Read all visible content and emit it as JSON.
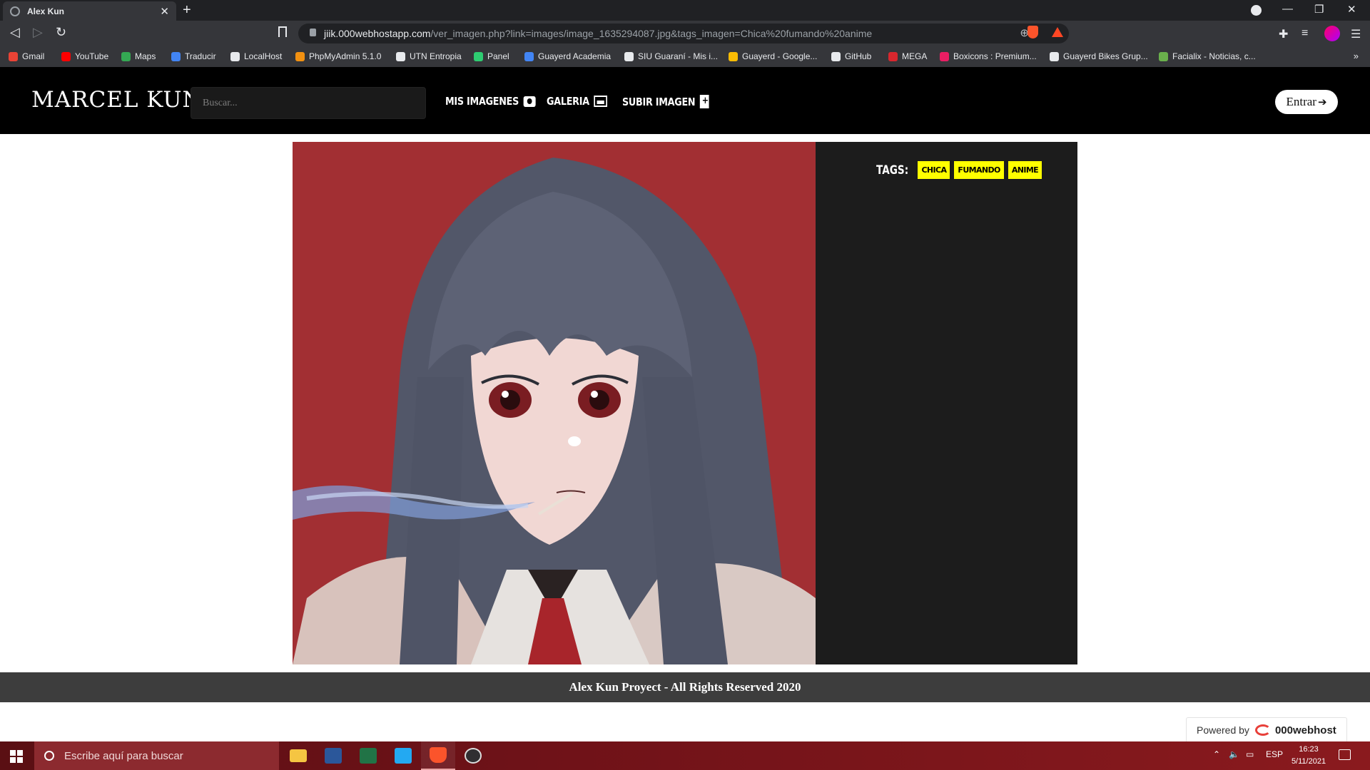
{
  "browser": {
    "tab_title": "Alex Kun",
    "url_host": "jiik.000webhostapp.com",
    "url_path": "/ver_imagen.php?link=images/image_1635294087.jpg&tags_imagen=Chica%20fumando%20anime",
    "bookmarks": [
      {
        "label": "Gmail",
        "color": "#ea4335"
      },
      {
        "label": "YouTube",
        "color": "#ff0000"
      },
      {
        "label": "Maps",
        "color": "#34a853"
      },
      {
        "label": "Traducir",
        "color": "#4285f4"
      },
      {
        "label": "LocalHost",
        "color": "#e8eaed"
      },
      {
        "label": "PhpMyAdmin 5.1.0",
        "color": "#f29111"
      },
      {
        "label": "UTN Entropia",
        "color": "#e8eaed"
      },
      {
        "label": "Panel",
        "color": "#2ecc71"
      },
      {
        "label": "Guayerd Academia",
        "color": "#4285f4"
      },
      {
        "label": "SIU Guaraní - Mis i...",
        "color": "#e8eaed"
      },
      {
        "label": "Guayerd - Google...",
        "color": "#fbbc04"
      },
      {
        "label": "GitHub",
        "color": "#e8eaed"
      },
      {
        "label": "MEGA",
        "color": "#d9272e"
      },
      {
        "label": "Boxicons : Premium...",
        "color": "#e91e63"
      },
      {
        "label": "Guayerd Bikes Grup...",
        "color": "#e8eaed"
      },
      {
        "label": "Facialix - Noticias, c...",
        "color": "#6ab04c"
      }
    ]
  },
  "site": {
    "logo": "MARCEL KUN",
    "search_placeholder": "Buscar...",
    "nav": {
      "my_images": "Mis Imagenes",
      "gallery": "Galeria",
      "upload": "Subir Imagen"
    },
    "login_label": "Entrar",
    "tags_label": "TAGS:",
    "tags": [
      "chica",
      "fumando",
      "anime"
    ],
    "footer": "Alex Kun Proyect - All Rights Reserved 2020",
    "powered_by": "Powered by",
    "host_brand": "000webhost"
  },
  "taskbar": {
    "search_placeholder": "Escribe aquí para buscar",
    "language": "ESP",
    "time": "16:23",
    "date": "5/11/2021"
  }
}
